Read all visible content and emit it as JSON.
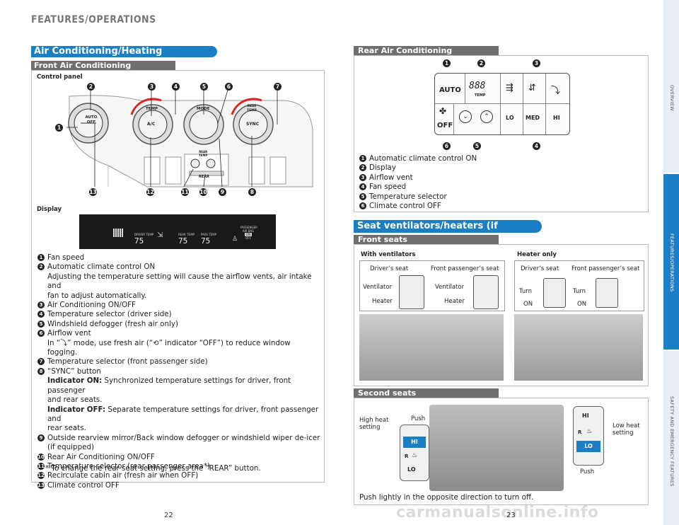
{
  "header": {
    "title": "FEATURES/OPERATIONS"
  },
  "left": {
    "section_title": "Air Conditioning/Heating",
    "subsection": "Front Air Conditioning",
    "control_panel_label": "Control panel",
    "display_label": "Display",
    "panel": {
      "knob_left": [
        "AUTO",
        "OFF"
      ],
      "knob_temp": [
        "TEMP",
        "A/C"
      ],
      "knob_mode": "MODE",
      "knob_sync": [
        "PASS",
        "TEMP",
        "SYNC"
      ],
      "rear_temp": [
        "REAR",
        "TEMP",
        "REAR"
      ]
    },
    "display": {
      "driver_temp_label": "DRIVER TEMP",
      "rear_temp_label": "REAR TEMP",
      "pass_temp_label": "PASS TEMP",
      "driver_temp": "75",
      "rear_temp": "75",
      "pass_temp": "75",
      "airbag": [
        "PASSENGER",
        "AIR BAG",
        "ON",
        "OFF"
      ]
    },
    "callouts_top": [
      "2",
      "3",
      "4",
      "5",
      "6",
      "7"
    ],
    "callouts_bottom": [
      "13",
      "12",
      "11",
      "10",
      "9",
      "8"
    ],
    "callout_1": "1",
    "items": [
      {
        "num": "1",
        "lines": [
          "Fan speed"
        ]
      },
      {
        "num": "2",
        "lines": [
          "Automatic climate control ON",
          "Adjusting the temperature setting will cause the airflow vents, air intake and",
          "fan to adjust automatically."
        ]
      },
      {
        "num": "3",
        "lines": [
          "Air Conditioning ON/OFF"
        ]
      },
      {
        "num": "4",
        "lines": [
          "Temperature selector (driver side)"
        ]
      },
      {
        "num": "5",
        "lines": [
          "Windshield defogger (fresh air only)"
        ]
      },
      {
        "num": "6",
        "lines": [
          "Airflow vent"
        ]
      },
      {
        "num": "7",
        "lines": [
          "Temperature selector (front passenger side)"
        ]
      },
      {
        "num": "8",
        "lines": [
          "“SYNC” button"
        ]
      },
      {
        "num": "9",
        "lines": [
          "Outside rearview mirror/Back window defogger or windshield wiper de-icer",
          "(if equipped)"
        ]
      },
      {
        "num": "10",
        "lines": [
          "Rear Air Conditioning ON/OFF"
        ]
      },
      {
        "num": "11",
        "lines": [
          "Temperature selector (rear passenger area*)"
        ]
      },
      {
        "num": "12",
        "lines": [
          "Recirculate cabin air (fresh air when OFF)"
        ]
      },
      {
        "num": "13",
        "lines": [
          "Climate control OFF"
        ]
      }
    ],
    "airflow_text": {
      "a": "In “",
      "b": "” mode, use fresh air (“",
      "c": "” indicator “OFF”) to reduce window",
      "d": "fogging."
    },
    "sync_on": {
      "label": "Indicator ON:",
      "text": " Synchronized temperature settings for driver, front passenger",
      "text2": "and rear seats."
    },
    "sync_off": {
      "label": "Indicator OFF:",
      "text": " Separate temperature settings for driver, front passenger and",
      "text2": "rear seats."
    },
    "footnote": "* To change the rear seat setting, press the “REAR” button.",
    "page_number": "22"
  },
  "right": {
    "rear_ac_title": "Rear Air Conditioning",
    "rear_panel": {
      "auto": "AUTO",
      "display": "888",
      "temp": "TEMP",
      "off": "OFF",
      "lo": "LO",
      "med": "MED",
      "hi": "HI"
    },
    "rear_callouts_top": [
      "1",
      "2",
      "3"
    ],
    "rear_callouts_bottom": [
      "6",
      "5",
      "4"
    ],
    "rear_items": [
      {
        "num": "1",
        "text": "Automatic climate control ON"
      },
      {
        "num": "2",
        "text": "Display"
      },
      {
        "num": "3",
        "text": "Airflow vent"
      },
      {
        "num": "4",
        "text": "Fan speed"
      },
      {
        "num": "5",
        "text": "Temperature selector"
      },
      {
        "num": "6",
        "text": "Climate control OFF"
      }
    ],
    "seat_title": "Seat ventilators/heaters (if equipped)",
    "front_seats_title": "Front seats",
    "with_ventilators": "With ventilators",
    "heater_only": "Heater only",
    "drivers_seat": "Driver’s seat",
    "front_pass_seat": "Front passenger’s seat",
    "ventilator": "Ventilator",
    "heater": "Heater",
    "turn": "Turn",
    "on": "ON",
    "second_seats_title": "Second seats",
    "high_heat": [
      "High heat",
      "setting"
    ],
    "low_heat": [
      "Low heat",
      "setting"
    ],
    "push": "Push",
    "hi": "HI",
    "lo": "LO",
    "r": "R",
    "push_note": "Push lightly in the opposite direction to turn off.",
    "page_number": "23"
  },
  "side_tabs": [
    "OVERVIEW",
    "FEATURES/OPERATIONS",
    "SAFETY AND EMERGENCY FEATURES"
  ],
  "watermark": "carmanualsonline.info",
  "colors": {
    "accent": "#1a7fc4",
    "gray_bar": "#6f6f6f",
    "side_tab": "#e9eef4"
  }
}
